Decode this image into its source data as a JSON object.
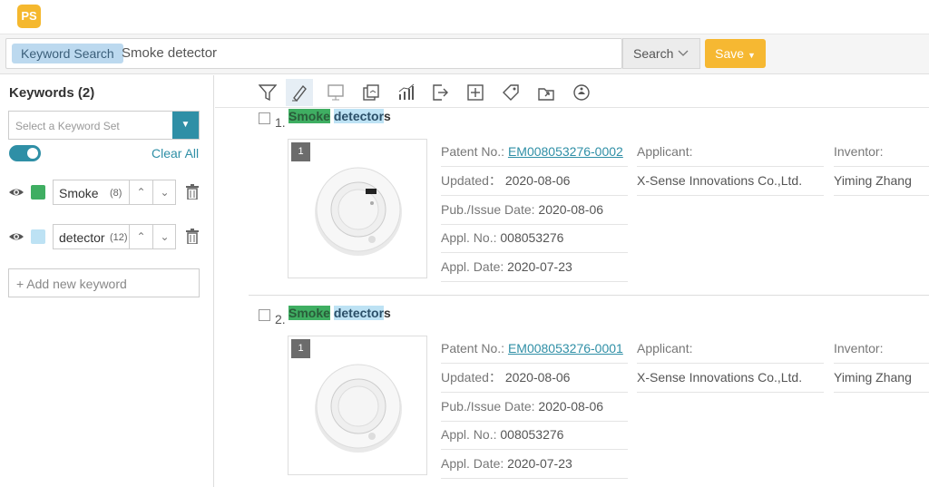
{
  "app": {
    "logo_text": "PS",
    "logo_color": "#f5b82e",
    "accent_color": "#2f8fa6"
  },
  "search": {
    "mode_chip": "Keyword Search",
    "query": "Smoke detector",
    "search_button": "Search",
    "save_button": "Save"
  },
  "sidebar": {
    "title": "Keywords (2)",
    "keyword_set_placeholder": "Select a Keyword Set",
    "toggle_on": true,
    "clear_all": "Clear All",
    "keywords": [
      {
        "text": "Smoke",
        "count": "(8)",
        "color": "#3fae62"
      },
      {
        "text": "detector",
        "count": "(12)",
        "color": "#bde2f4"
      }
    ],
    "add_keyword": "+ Add new keyword"
  },
  "toolbar": {
    "tools": [
      "filter-icon",
      "highlight-pen-icon",
      "monitor-icon",
      "compare-icon",
      "analytics-icon",
      "export-icon",
      "add-box-icon",
      "tag-icon",
      "move-icon",
      "alert-icon"
    ]
  },
  "results": [
    {
      "number": "1.",
      "title_word1": "Smoke",
      "title_word2": "detector",
      "title_tail": "s",
      "image_badge": "1",
      "patent_label": "Patent No.:",
      "patent_no": "EM008053276-0002",
      "updated_label": "Updated：",
      "updated": "2020-08-06",
      "pub_label": "Pub./Issue Date:",
      "pub_date": "2020-08-06",
      "appl_no_label": "Appl. No.:",
      "appl_no": "008053276",
      "appl_date_label": "Appl. Date:",
      "appl_date": "2020-07-23",
      "applicant_label": "Applicant:",
      "applicant": "X-Sense Innovations Co.,Ltd.",
      "inventor_label": "Inventor:",
      "inventor": "Yiming Zhang"
    },
    {
      "number": "2.",
      "title_word1": "Smoke",
      "title_word2": "detector",
      "title_tail": "s",
      "image_badge": "1",
      "patent_label": "Patent No.:",
      "patent_no": "EM008053276-0001",
      "updated_label": "Updated：",
      "updated": "2020-08-06",
      "pub_label": "Pub./Issue Date:",
      "pub_date": "2020-08-06",
      "appl_no_label": "Appl. No.:",
      "appl_no": "008053276",
      "appl_date_label": "Appl. Date:",
      "appl_date": "2020-07-23",
      "applicant_label": "Applicant:",
      "applicant": "X-Sense Innovations Co.,Ltd.",
      "inventor_label": "Inventor:",
      "inventor": "Yiming Zhang"
    }
  ]
}
